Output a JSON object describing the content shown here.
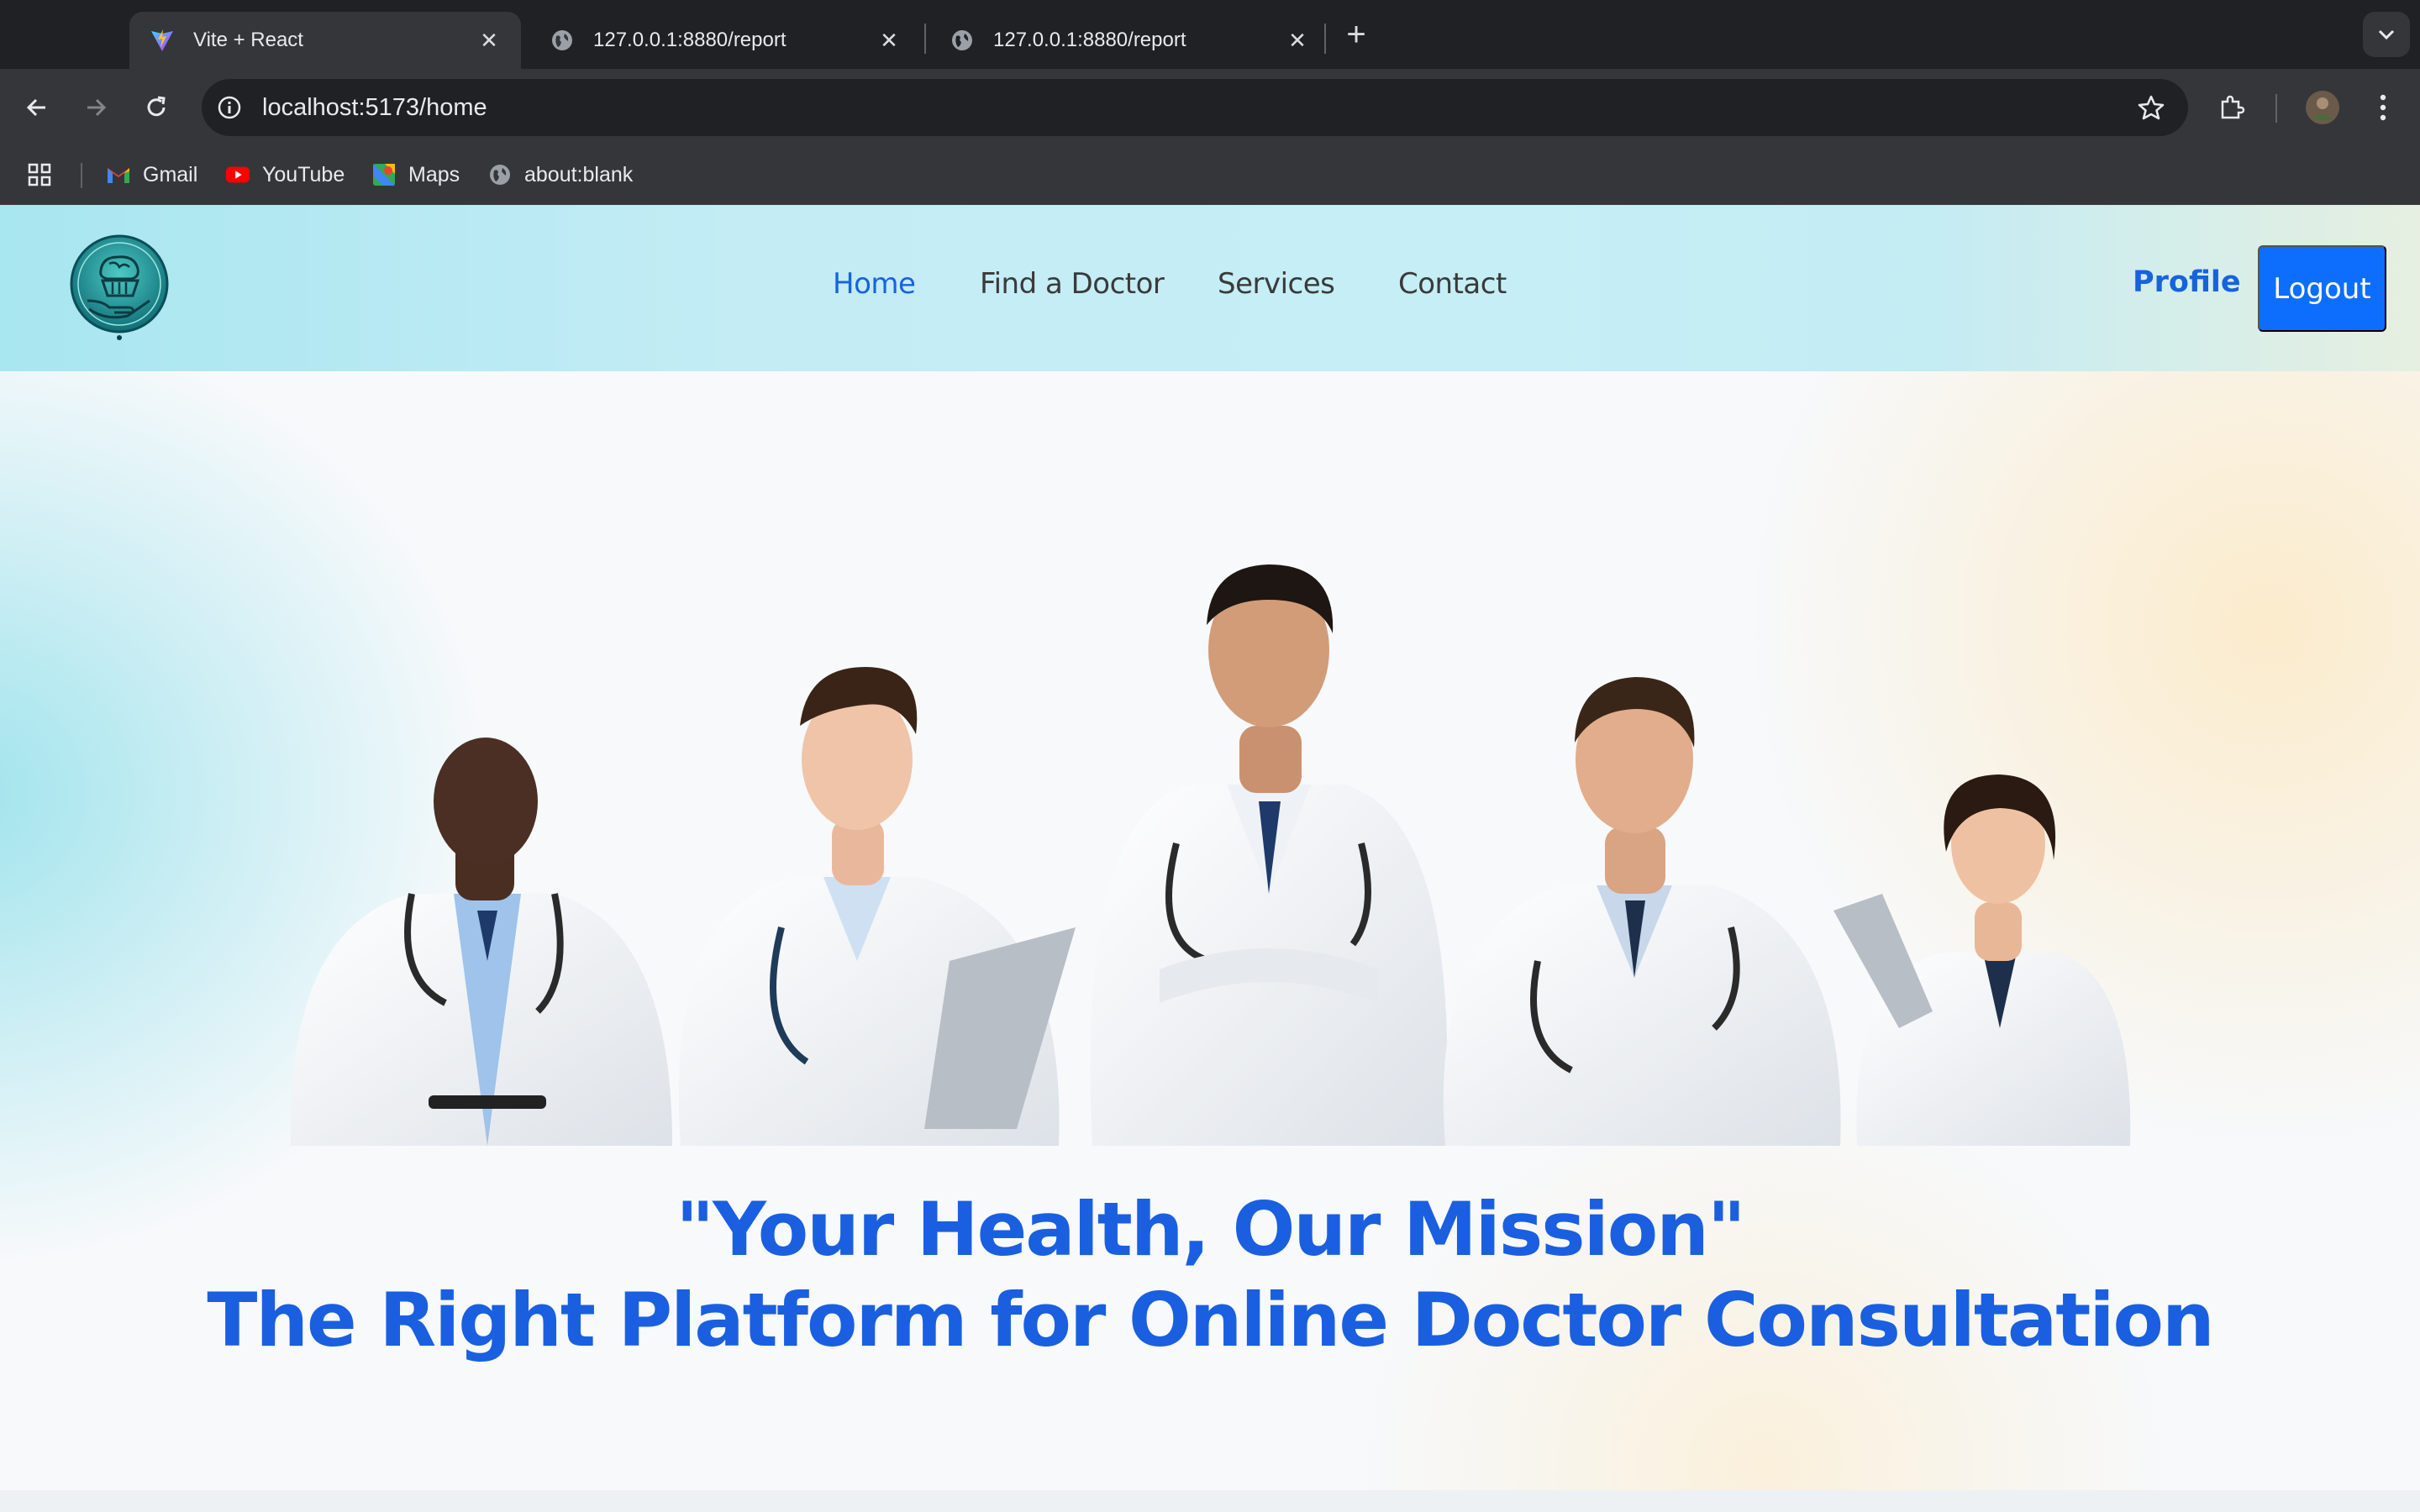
{
  "browser": {
    "tabs": [
      {
        "label": "Vite + React",
        "icon": "vite-icon",
        "active": true
      },
      {
        "label": "127.0.0.1:8880/report",
        "icon": "globe-icon",
        "active": false
      },
      {
        "label": "127.0.0.1:8880/report",
        "icon": "globe-icon",
        "active": false
      }
    ],
    "url": "localhost:5173/home",
    "bookmarks": [
      {
        "label": "Gmail",
        "icon": "gmail-icon"
      },
      {
        "label": "YouTube",
        "icon": "youtube-icon"
      },
      {
        "label": "Maps",
        "icon": "maps-icon"
      },
      {
        "label": "about:blank",
        "icon": "globe-icon"
      }
    ]
  },
  "navbar": {
    "links": [
      "Home",
      "Find a Doctor",
      "Services",
      "Contact"
    ],
    "active_link": "Home",
    "profile_label": "Profile",
    "logout_label": "Logout"
  },
  "hero": {
    "tagline": "\"Your Health, Our Mission\"",
    "headline": "The Right Platform for Online Doctor Consultation"
  },
  "colors": {
    "brand_blue": "#1663dd",
    "logout_bg": "#0d6efd",
    "chrome_dark": "#202124",
    "chrome_mid": "#35363a"
  }
}
